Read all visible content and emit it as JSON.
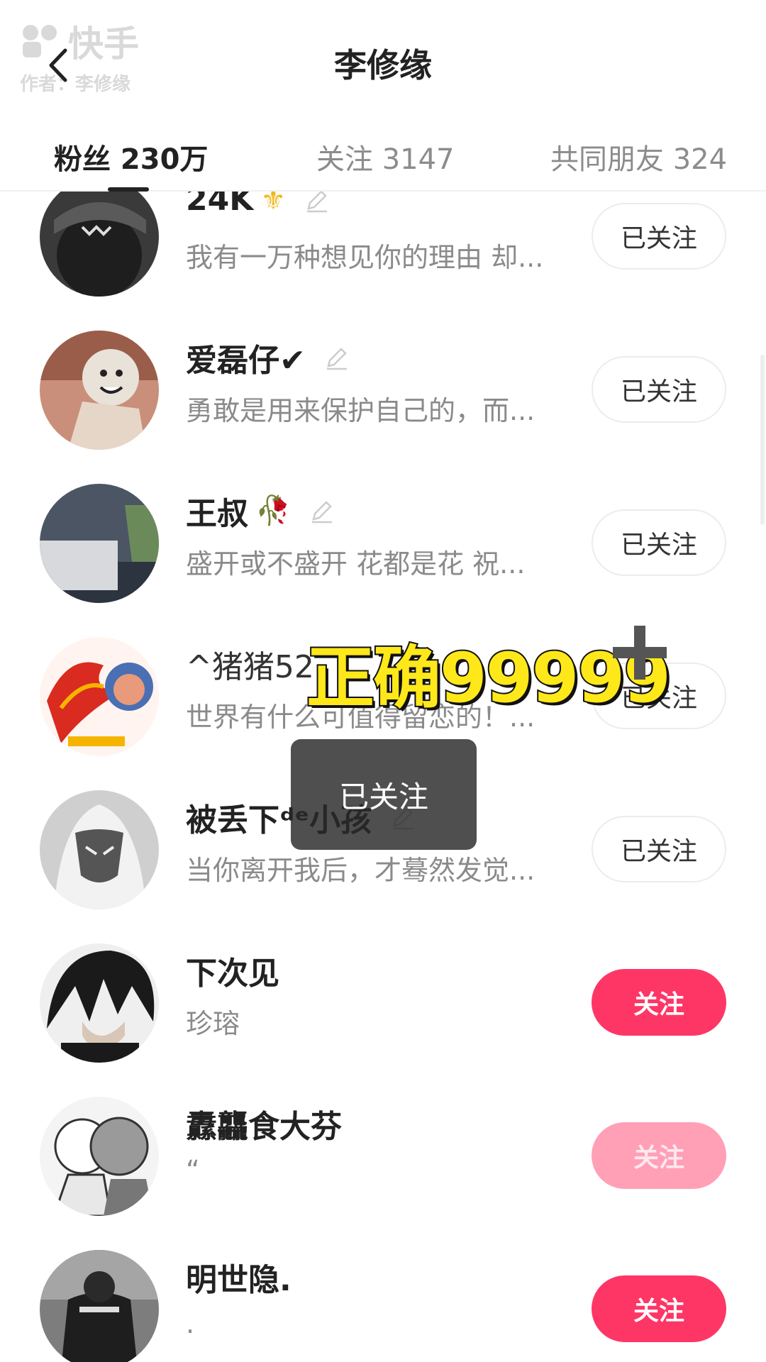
{
  "watermark": {
    "logo_text": "快手",
    "author": "作者：李修缘"
  },
  "header": {
    "title": "李修缘",
    "back_icon": "chevron-left-icon"
  },
  "tabs": [
    {
      "label": "粉丝 230万",
      "active": true
    },
    {
      "label": "关注 3147",
      "active": false
    },
    {
      "label": "共同朋友 324",
      "active": false
    }
  ],
  "users": [
    {
      "name": "24K",
      "badge": "⚜",
      "bio": "我有一万种想见你的理由 却...",
      "button": "已关注",
      "state": "followed",
      "editable": true
    },
    {
      "name": "爱磊仔✔",
      "badge": "",
      "bio": "勇敢是用来保护自己的，而...",
      "button": "已关注",
      "state": "followed",
      "editable": true
    },
    {
      "name": "王叔",
      "badge": "🥀",
      "bio": "盛开或不盛开  花都是花  祝...",
      "button": "已关注",
      "state": "followed",
      "editable": true
    },
    {
      "name": "^猪猪52",
      "badge": "",
      "bio": "世界有什么可值得留恋的！...",
      "button": "已关注",
      "state": "followed",
      "editable": false
    },
    {
      "name": "被丢下ᵈᵉ小孩",
      "badge": "",
      "bio": "当你离开我后，才蓦然发觉...",
      "button": "已关注",
      "state": "followed",
      "editable": true
    },
    {
      "name": "下次见",
      "badge": "",
      "bio": "珍瑢",
      "button": "关注",
      "state": "follow",
      "editable": false
    },
    {
      "name": "纛龘食大芬",
      "badge": "",
      "bio": "“",
      "button": "关注",
      "state": "follow-faded",
      "editable": false
    },
    {
      "name": "明世隐.",
      "badge": "",
      "bio": ".",
      "button": "关注",
      "state": "follow",
      "editable": false
    }
  ],
  "overlay": {
    "text": "正确99999",
    "plus_icon": "plus-icon"
  },
  "toast": {
    "text": "已关注"
  },
  "colors": {
    "accent": "#fe3666",
    "accent_faded": "#ffa0b6",
    "overlay_text": "#ffe81a",
    "muted": "#8a8a8a"
  }
}
